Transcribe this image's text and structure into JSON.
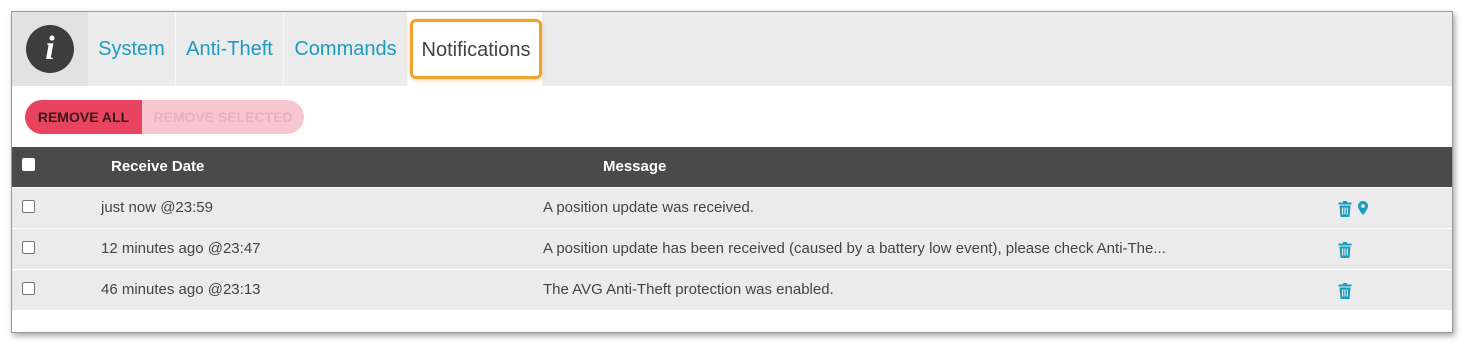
{
  "colors": {
    "tab_link": "#1b9bc0",
    "active_highlight": "#f0a030",
    "remove_all_bg": "#e8445f",
    "remove_selected_bg": "#f7c6ce",
    "header_bg": "#4a4a4a",
    "row_bg": "#ebebeb",
    "action_icon": "#1b9bc0"
  },
  "header": {
    "info_icon": "info-icon",
    "info_glyph": "i",
    "tabs": [
      {
        "label": "System",
        "active": false
      },
      {
        "label": "Anti-Theft",
        "active": false
      },
      {
        "label": "Commands",
        "active": false
      },
      {
        "label": "Notifications",
        "active": true
      }
    ]
  },
  "toolbar": {
    "remove_all_label": "REMOVE ALL",
    "remove_selected_label": "REMOVE SELECTED",
    "remove_selected_disabled": true
  },
  "table": {
    "columns": [
      "Receive Date",
      "Message"
    ],
    "rows": [
      {
        "date": "just now @23:59",
        "message": "A position update was received.",
        "icons": [
          "trash-icon",
          "location-pin-icon"
        ]
      },
      {
        "date": "12 minutes ago @23:47",
        "message": "A position update has been received (caused by a battery low event), please check Anti-The...",
        "icons": [
          "trash-icon"
        ]
      },
      {
        "date": "46 minutes ago @23:13",
        "message": "The AVG Anti-Theft protection was enabled.",
        "icons": [
          "trash-icon"
        ]
      }
    ]
  }
}
